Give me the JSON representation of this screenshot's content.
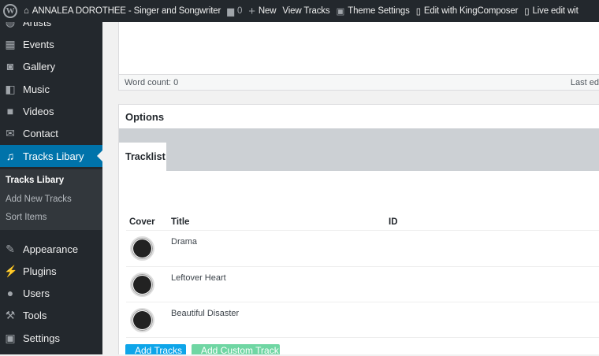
{
  "topbar": {
    "site": "ANNALEA DOROTHEE - Singer and Songwriter",
    "comments": "0",
    "new": "New",
    "view": "View Tracks",
    "theme": "Theme Settings",
    "kc": "Edit with KingComposer",
    "live": "Live edit wit"
  },
  "sidebar": {
    "items": [
      {
        "label": "Artists",
        "icon": "artists-icon"
      },
      {
        "label": "Events"
      },
      {
        "label": "Gallery"
      },
      {
        "label": "Music"
      },
      {
        "label": "Videos"
      },
      {
        "label": "Contact"
      },
      {
        "label": "Tracks Libary"
      },
      {
        "label": "Appearance"
      },
      {
        "label": "Plugins"
      },
      {
        "label": "Users"
      },
      {
        "label": "Tools"
      },
      {
        "label": "Settings"
      }
    ],
    "submenu": [
      "Tracks Libary",
      "Add New Tracks",
      "Sort Items"
    ]
  },
  "editor": {
    "word_count": "Word count: 0",
    "last_edited": "Last ed"
  },
  "options": {
    "title": "Options",
    "tab": "Tracklist",
    "columns": [
      "Cover",
      "Title",
      "ID"
    ],
    "tracks": [
      "Drama",
      "Leftover Heart",
      "Beautiful Disaster"
    ],
    "add_tracks": "Add Tracks",
    "add_custom": "Add Custom Track"
  }
}
